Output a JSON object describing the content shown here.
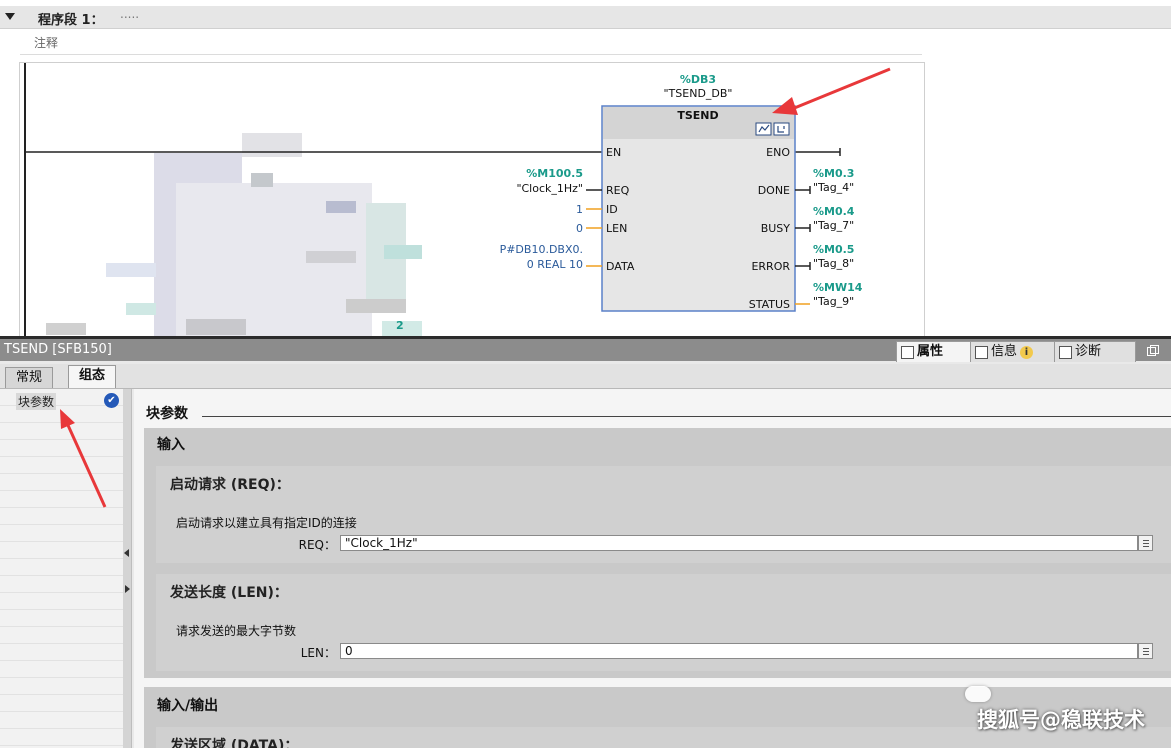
{
  "editor": {
    "segment_title": "程序段 1：",
    "segment_dots": ".....",
    "comment": "注释",
    "block": {
      "db_address": "%DB3",
      "db_name": "\"TSEND_DB\"",
      "name": "TSEND",
      "en": "EN",
      "eno": "ENO",
      "inputs": [
        {
          "pin": "REQ",
          "address": "%M100.5",
          "tag": "\"Clock_1Hz\""
        },
        {
          "pin": "ID",
          "value": "1"
        },
        {
          "pin": "LEN",
          "value": "0"
        },
        {
          "pin": "DATA",
          "value_line1": "P#DB10.DBX0.",
          "value_line2": "0 REAL 10"
        }
      ],
      "outputs": [
        {
          "pin": "DONE",
          "address": "%M0.3",
          "tag": "\"Tag_4\""
        },
        {
          "pin": "BUSY",
          "address": "%M0.4",
          "tag": "\"Tag_7\""
        },
        {
          "pin": "ERROR",
          "address": "%M0.5",
          "tag": "\"Tag_8\""
        },
        {
          "pin": "STATUS",
          "address": "%MW14",
          "tag": "\"Tag_9\""
        }
      ]
    },
    "blurred_fragment": "2"
  },
  "properties": {
    "title": "TSEND [SFB150]",
    "tabs": [
      {
        "label": "属性",
        "icon": "properties-icon",
        "active": true
      },
      {
        "label": "信息",
        "icon": "info-icon",
        "badge": "i"
      },
      {
        "label": "诊断",
        "icon": "diagnostics-icon"
      }
    ],
    "subtabs": [
      {
        "label": "常规",
        "active": false
      },
      {
        "label": "组态",
        "active": true
      }
    ],
    "nav": {
      "item": "块参数",
      "check": "✔"
    },
    "content": {
      "heading": "块参数",
      "input_group": "输入",
      "params": [
        {
          "title": "启动请求 (REQ)：",
          "description": "启动请求以建立具有指定ID的连接",
          "label": "REQ：",
          "value": "\"Clock_1Hz\""
        },
        {
          "title": "发送长度 (LEN)：",
          "description": "请求发送的最大字节数",
          "label": "LEN：",
          "value": "0"
        }
      ],
      "inout_group": "输入/输出",
      "data_param_title": "发送区域 (DATA)："
    }
  },
  "watermark": "搜狐号@稳联技术",
  "colors": {
    "address": "#1a9a8a",
    "value": "#2a5a9a",
    "block_border": "#5a80c8",
    "block_header": "#d4d4d4",
    "wire": "#222222",
    "pin_tick": "#f0a020",
    "arrow": "#e8383a",
    "check": "#2459b8"
  }
}
